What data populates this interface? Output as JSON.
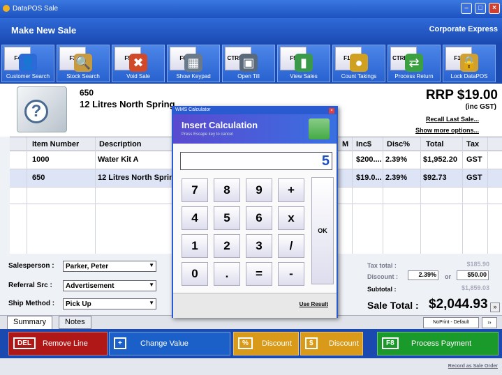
{
  "window": {
    "title": "DataPOS Sale"
  },
  "header": {
    "title": "Make New Sale",
    "company": "Corporate Express"
  },
  "toolbar": [
    {
      "key": "F4",
      "label": "Customer Search",
      "icon": "customer-icon",
      "color": "#2c6ad8",
      "glyph": "👤"
    },
    {
      "key": "F3",
      "label": "Stock Search",
      "icon": "stock-search-icon",
      "color": "#c89a40",
      "glyph": "🔍"
    },
    {
      "key": "F5",
      "label": "Void Sale",
      "icon": "void-icon",
      "color": "#d04a2a",
      "glyph": "✖"
    },
    {
      "key": "F6",
      "label": "Show Keypad",
      "icon": "keypad-icon",
      "color": "#6a7a8a",
      "glyph": "▦"
    },
    {
      "key": "CTRL+T",
      "label": "Open Till",
      "icon": "till-icon",
      "color": "#5a6a7a",
      "glyph": "▣"
    },
    {
      "key": "F9",
      "label": "View Sales",
      "icon": "chart-icon",
      "color": "#3a9a4a",
      "glyph": "▮"
    },
    {
      "key": "F10",
      "label": "Count Takings",
      "icon": "coin-icon",
      "color": "#d0a020",
      "glyph": "●"
    },
    {
      "key": "CTRL+R",
      "label": "Process Return",
      "icon": "return-icon",
      "color": "#3aa040",
      "glyph": "⇄"
    },
    {
      "key": "F11",
      "label": "Lock DataPOS",
      "icon": "lock-icon",
      "color": "#d0a030",
      "glyph": "🔒"
    }
  ],
  "product": {
    "number": "650",
    "name": "12 Litres North Spring",
    "rrp": "RRP $19.00",
    "inc": "(inc GST)",
    "recall": "Recall Last Sale...",
    "more": "Show more options..."
  },
  "grid": {
    "columns": [
      "Item Number",
      "Description",
      "M",
      "Inc$",
      "Disc%",
      "Total",
      "Tax"
    ],
    "rows": [
      {
        "item": "1000",
        "desc": "Water Kit A",
        "inc": "$200....",
        "disc": "2.39%",
        "total": "$1,952.20",
        "tax": "GST"
      },
      {
        "item": "650",
        "desc": "12 Litres North Spring",
        "inc": "$19.0...",
        "disc": "2.39%",
        "total": "$92.73",
        "tax": "GST"
      }
    ]
  },
  "form": {
    "salesperson_label": "Salesperson :",
    "salesperson": "Parker, Peter",
    "referral_label": "Referral Src :",
    "referral": "Advertisement",
    "ship_label": "Ship Method :",
    "ship": "Pick Up"
  },
  "totals": {
    "tax_label": "Tax total :",
    "tax": "$185.90",
    "discount_label": "Discount :",
    "discount_pct": "2.39%",
    "or": "or",
    "discount_amt": "$50.00",
    "subtotal_label": "Subtotal :",
    "subtotal": "$1,859.03",
    "sale_label": "Sale Total :",
    "sale": "$2,044.93"
  },
  "tabs": {
    "summary": "Summary",
    "notes": "Notes",
    "print": "NoPrint - Default"
  },
  "actions": {
    "del_key": "DEL",
    "del": "Remove Line",
    "change": "Change Value",
    "pct_key": "%",
    "pct": "Discount",
    "dollar_key": "$",
    "dollar": "Discount",
    "f8": "F8",
    "pay": "Process Payment"
  },
  "footer": {
    "record": "Record as Sale Order"
  },
  "calc": {
    "title": "WMS Calculator",
    "heading": "Insert Calculation",
    "hint": "Press Escape key to cancel",
    "display": "5",
    "keys": [
      "7",
      "8",
      "9",
      "+",
      "4",
      "5",
      "6",
      "x",
      "1",
      "2",
      "3",
      "/",
      "0",
      ".",
      "=",
      "-"
    ],
    "ok": "OK",
    "use": "Use Result"
  }
}
